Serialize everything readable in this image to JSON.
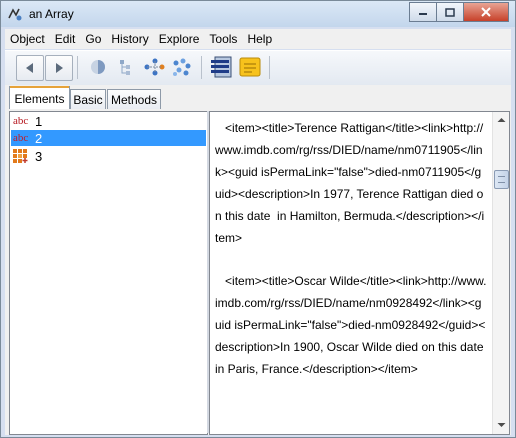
{
  "window": {
    "title": "an Array",
    "controls": {
      "minimize": "minimize",
      "maximize": "maximize",
      "close": "close"
    }
  },
  "menu": [
    "Object",
    "Edit",
    "Go",
    "History",
    "Explore",
    "Tools",
    "Help"
  ],
  "toolbar": {
    "buttons": [
      "back-icon",
      "forward-icon",
      "inspect-icon",
      "hierarchy-icon",
      "dependencies-icon",
      "graph-icon",
      "list-view-icon",
      "notes-icon"
    ]
  },
  "tabs": [
    "Elements",
    "Basic",
    "Methods"
  ],
  "tree": [
    {
      "icon": "abc",
      "label": "1"
    },
    {
      "icon": "abc",
      "label": "2"
    },
    {
      "icon": "array-grid",
      "label": "3"
    }
  ],
  "detail": {
    "text": "   <item><title>Terence Rattigan</title><link>http://www.imdb.com/rg/rss/DIED/name/nm0711905</link><guid isPermaLink=\"false\">died-nm0711905</guid><description>In 1977, Terence Rattigan died on this date  in Hamilton, Bermuda.</description></item>\n\n   <item><title>Oscar Wilde</title><link>http://www.imdb.com/rg/rss/DIED/name/nm0928492</link><guid isPermaLink=\"false\">died-nm0928492</guid><description>In 1900, Oscar Wilde died on this date  in Paris, France.</description></item>"
  }
}
